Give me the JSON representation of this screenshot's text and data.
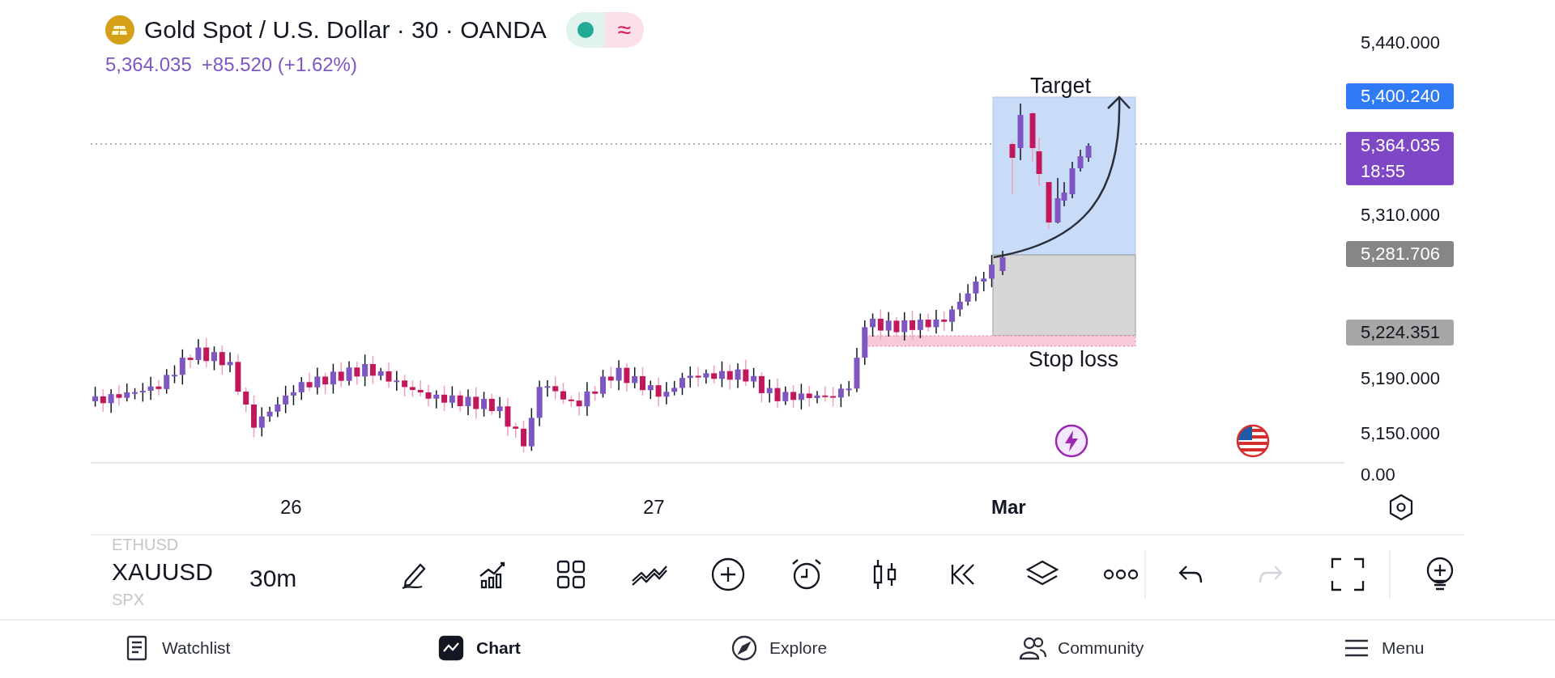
{
  "header": {
    "title": "Gold Spot / U.S. Dollar · 30 · OANDA",
    "market_open": true,
    "feed_symbol": "≈"
  },
  "quote": {
    "price": "5,364.035",
    "change": "+85.520",
    "change_percent": "(+1.62%)"
  },
  "price_axis": {
    "labels": [
      "5,440.000",
      "5,310.000",
      "5,190.000",
      "5,150.000"
    ],
    "tags": [
      {
        "kind": "target",
        "text": "5,400.240"
      },
      {
        "kind": "last",
        "text": "5,364.035",
        "sub": "18:55"
      },
      {
        "kind": "entry",
        "text": "5,281.706"
      },
      {
        "kind": "stop",
        "text": "5,224.351"
      }
    ],
    "indicator_value": "0.00"
  },
  "position": {
    "target_label": "Target",
    "stop_label": "Stop loss"
  },
  "time_axis": [
    {
      "label": "26",
      "bold": false
    },
    {
      "label": "27",
      "bold": false
    },
    {
      "label": "Mar",
      "bold": true
    }
  ],
  "toolbar": {
    "symbols": [
      {
        "label": "ETHUSD",
        "selected": false
      },
      {
        "label": "XAUUSD",
        "selected": true
      },
      {
        "label": "SPX",
        "selected": false
      }
    ],
    "interval": "30m",
    "actions": [
      {
        "kind": "undo",
        "disabled": false
      },
      {
        "kind": "redo",
        "disabled": true
      }
    ]
  },
  "nav": [
    {
      "label": "Watchlist",
      "selected": false
    },
    {
      "label": "Chart",
      "selected": true
    },
    {
      "label": "Explore",
      "selected": false
    },
    {
      "label": "Community",
      "selected": false
    },
    {
      "label": "Menu",
      "selected": false
    }
  ]
}
